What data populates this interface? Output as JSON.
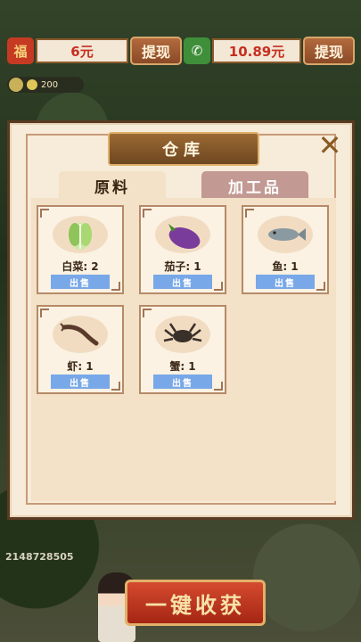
{
  "currency": {
    "red_icon": "福",
    "red_value": "6元",
    "red_btn": "提现",
    "wx_icon": "✆",
    "wx_value": "10.89元",
    "wx_btn": "提现"
  },
  "coins": {
    "value": "200"
  },
  "modal": {
    "title": "仓库",
    "close": "✕",
    "tabs": [
      {
        "label": "原料",
        "active": true
      },
      {
        "label": "加工品",
        "active": false
      }
    ],
    "items": [
      {
        "label": "白菜: 2",
        "icon": "cabbage-icon",
        "sell": "出售"
      },
      {
        "label": "茄子: 1",
        "icon": "eggplant-icon",
        "sell": "出售"
      },
      {
        "label": "鱼: 1",
        "icon": "fish-icon",
        "sell": "出售"
      },
      {
        "label": "虾: 1",
        "icon": "shrimp-icon",
        "sell": "出售"
      },
      {
        "label": "蟹: 1",
        "icon": "crab-icon",
        "sell": "出售"
      }
    ]
  },
  "footer": {
    "uid": "2148728505",
    "harvest_btn": "一键收获"
  }
}
